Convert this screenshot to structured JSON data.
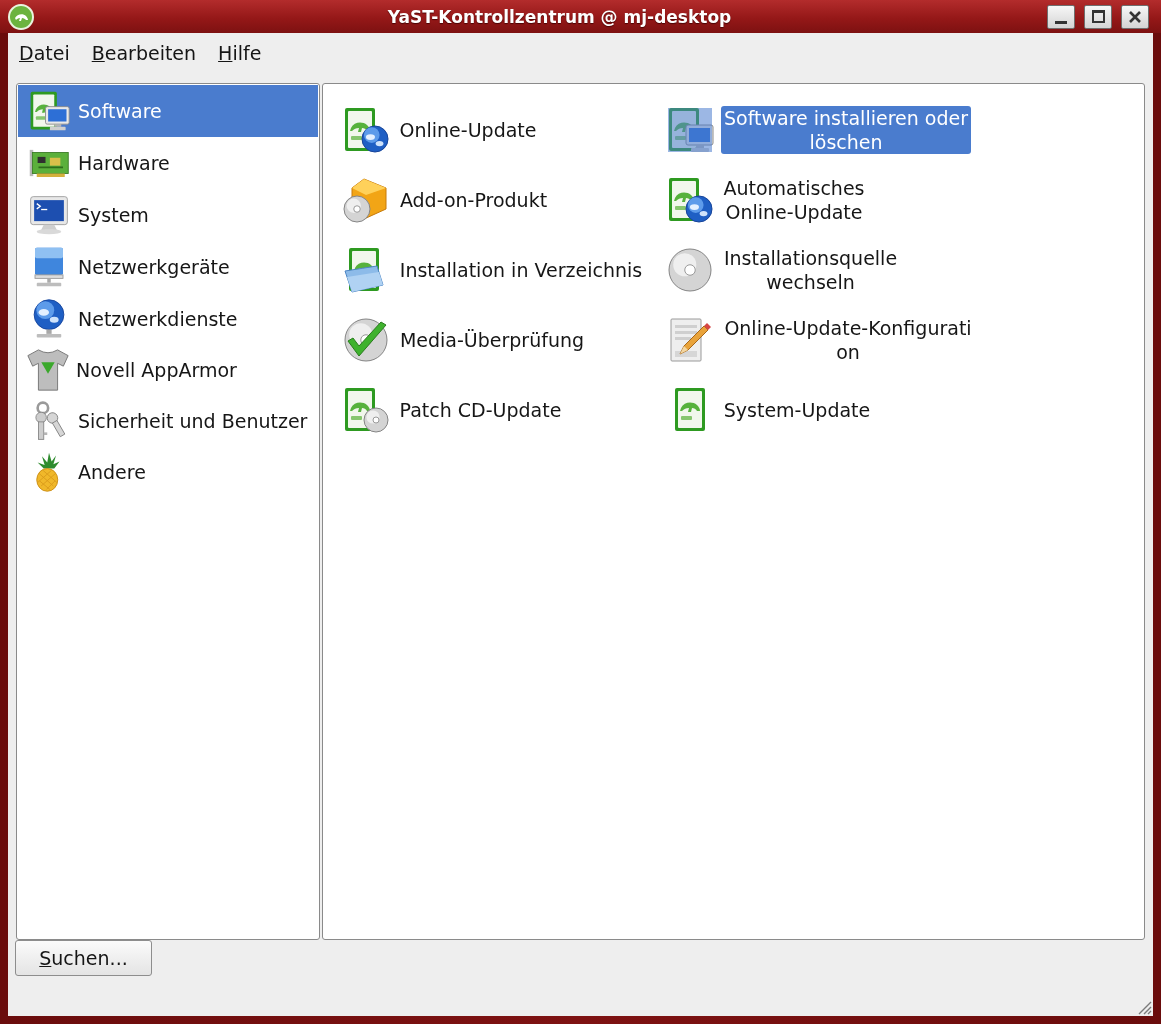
{
  "window": {
    "title": "YaST-Kontrollzentrum @ mj-desktop"
  },
  "menu": [
    {
      "label": "Datei"
    },
    {
      "label": "Bearbeiten"
    },
    {
      "label": "Hilfe"
    }
  ],
  "sidebar": {
    "items": [
      {
        "label": "Software",
        "selected": true
      },
      {
        "label": "Hardware",
        "selected": false
      },
      {
        "label": "System",
        "selected": false
      },
      {
        "label": "Netzwerkgeräte",
        "selected": false
      },
      {
        "label": "Netzwerkdienste",
        "selected": false
      },
      {
        "label": "Novell AppArmor",
        "selected": false
      },
      {
        "label": "Sicherheit und Benutzer",
        "selected": false
      },
      {
        "label": "Andere",
        "selected": false
      }
    ]
  },
  "modules": {
    "items": [
      {
        "label": "Online-Update",
        "selected": false
      },
      {
        "label": "Add-on-Produkt",
        "selected": false
      },
      {
        "label": "Installation in Verzeichnis",
        "selected": false
      },
      {
        "label": "Media-Überprüfung",
        "selected": false
      },
      {
        "label": "Patch CD-Update",
        "selected": false
      },
      {
        "label": "Software installieren oder löschen",
        "selected": true
      },
      {
        "label": "Automatisches Online-Update",
        "selected": false
      },
      {
        "label": "Installationsquelle wechseln",
        "selected": false
      },
      {
        "label": "Online-Update-Konfiguration",
        "selected": false
      },
      {
        "label": "System-Update",
        "selected": false
      }
    ]
  },
  "search_button": {
    "label": "Suchen..."
  }
}
